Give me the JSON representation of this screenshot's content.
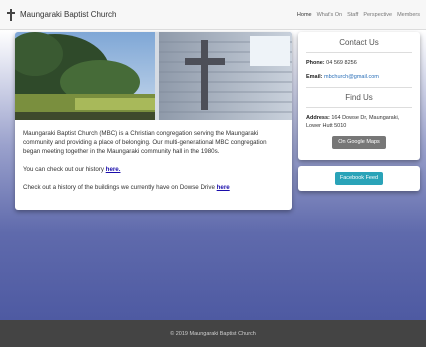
{
  "navbar": {
    "brand": "Maungaraki Baptist Church",
    "links": [
      "Home",
      "What's On",
      "Staff",
      "Perspective",
      "Members"
    ]
  },
  "main": {
    "paragraph1": "Maungaraki Baptist Church (MBC) is a Christian congregation serving the Maungaraki community and providing a place of belonging. Our multi-generational MBC congregation began meeting together in the Maungaraki community hall in the 1980s.",
    "history_text": "You can check out our history ",
    "history_link": "here.",
    "buildings_text": "Check out a history of the buildings we currently have on Dowse Drive ",
    "buildings_link": "here"
  },
  "contact": {
    "title": "Contact Us",
    "phone_label": "Phone:",
    "phone_value": "04 569 8256",
    "email_label": "Email:",
    "email_value": "mbchurch@gmail.com",
    "find_title": "Find Us",
    "address_label": "Address:",
    "address_value": "164 Dowse Dr, Maungaraki, Lower Hutt 5010",
    "maps_button": "On Google Maps"
  },
  "facebook": {
    "button": "Facebook Feed"
  },
  "footer": {
    "text": "© 2019 Maungaraki Baptist Church"
  },
  "colors": {
    "accent": "#2aa3b8",
    "footer_bg": "#444444",
    "gradient_bottom": "#4e5aa2"
  }
}
